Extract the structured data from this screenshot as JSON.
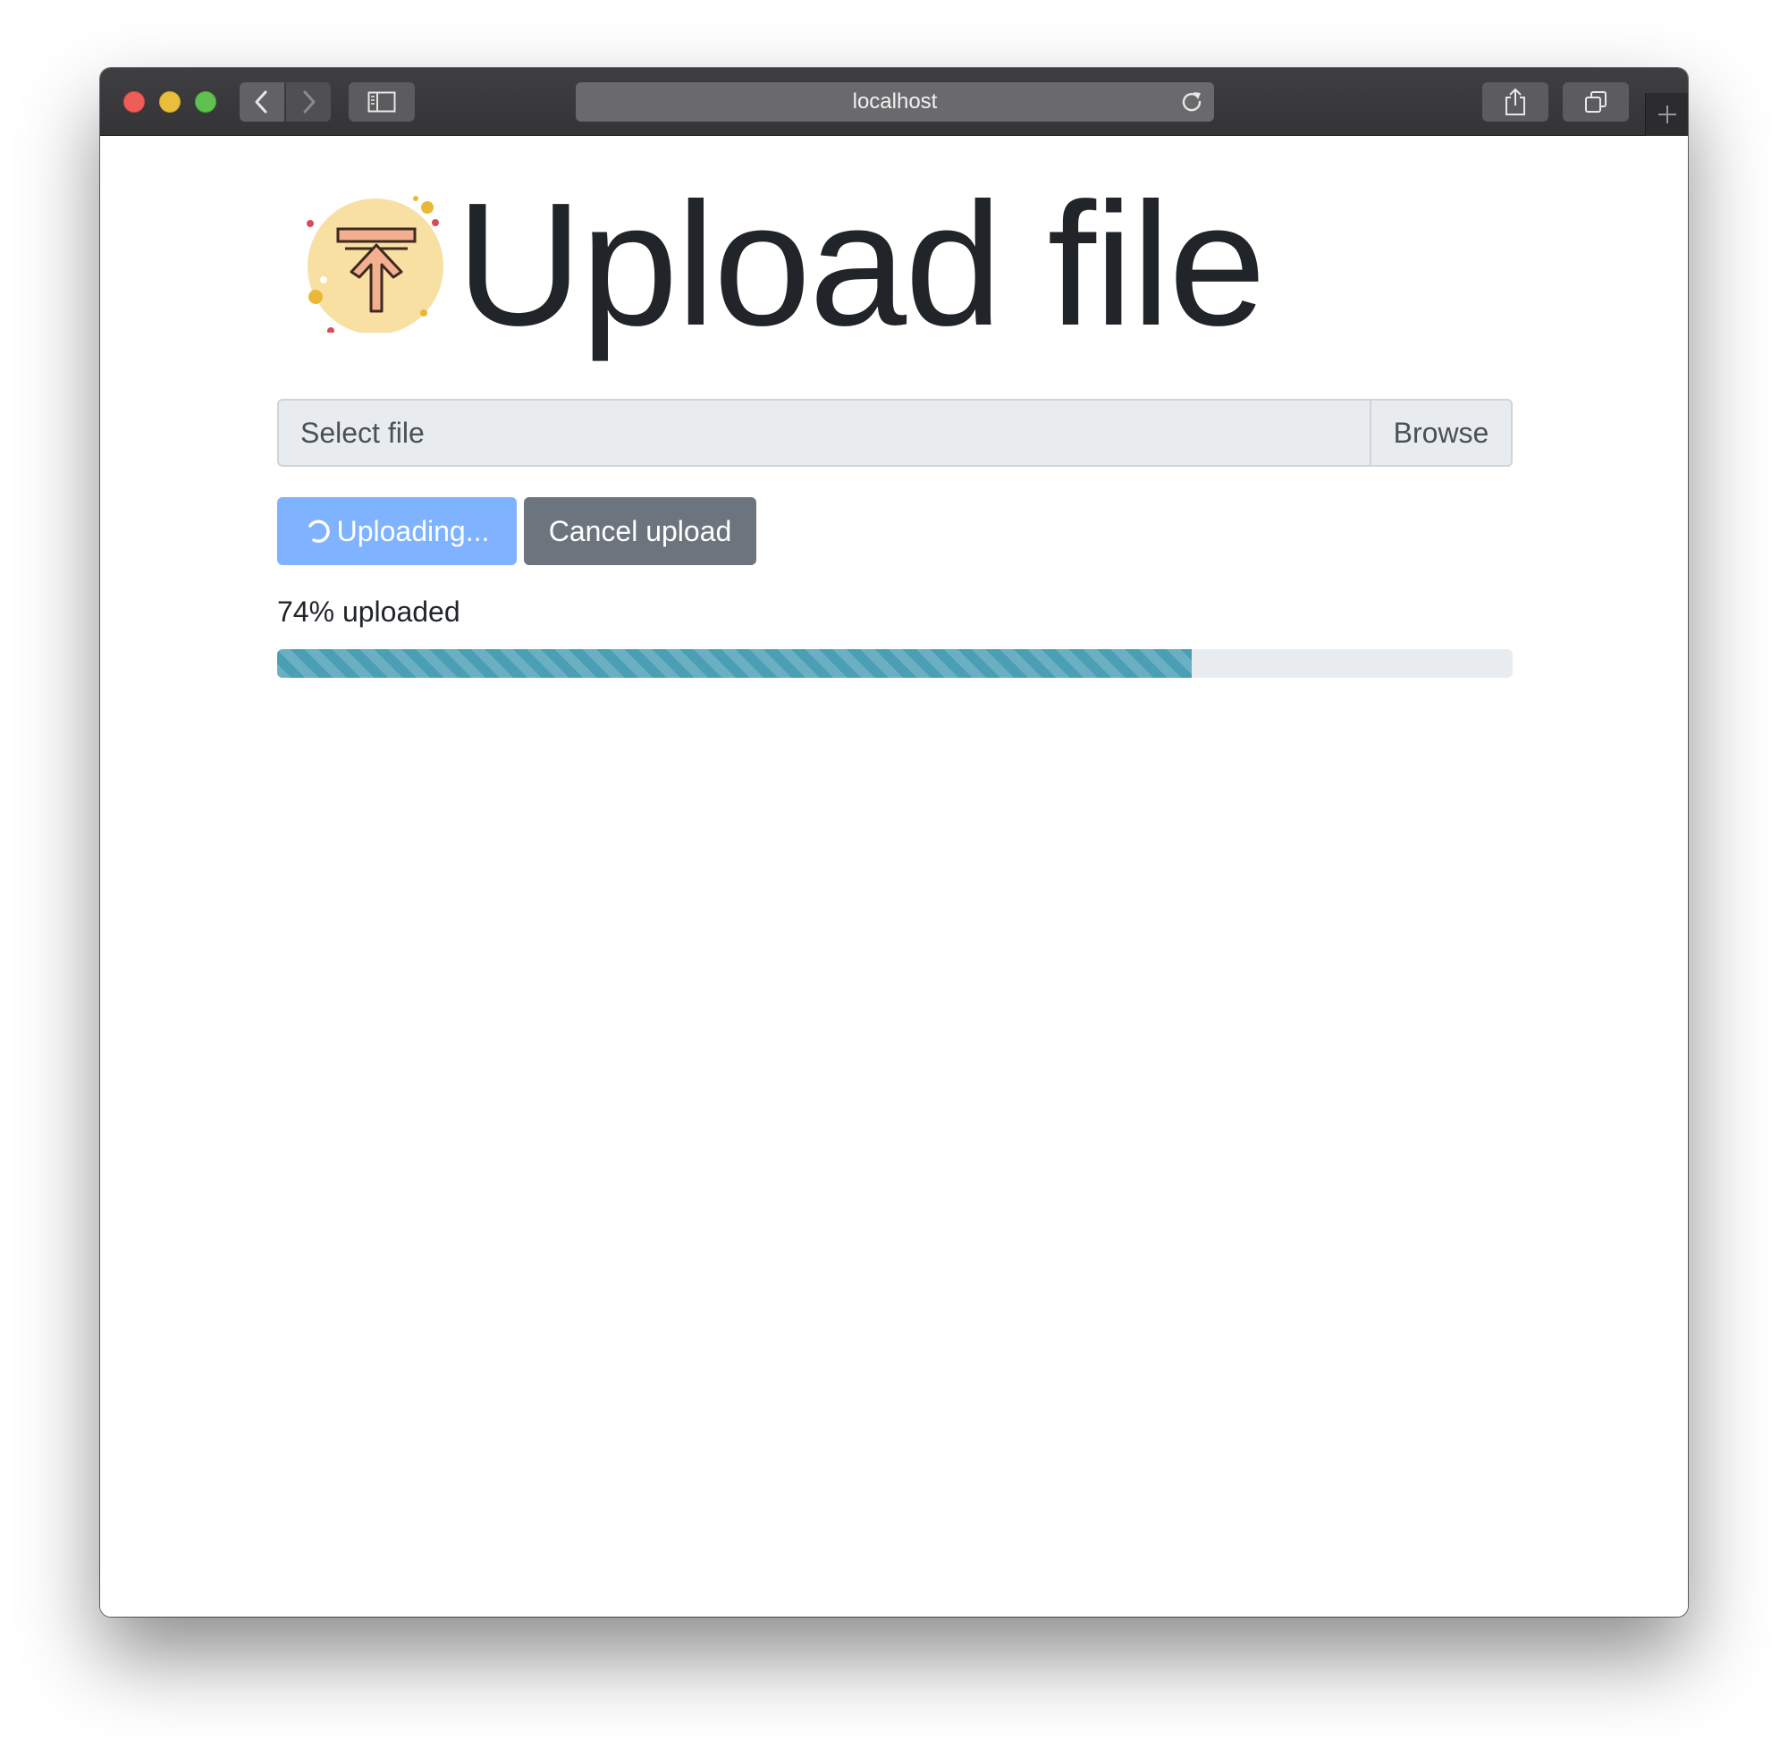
{
  "browser": {
    "url": "localhost"
  },
  "page": {
    "title": "Upload file"
  },
  "file_input": {
    "placeholder": "Select file",
    "browse_label": "Browse"
  },
  "actions": {
    "uploading_label": "Uploading...",
    "cancel_label": "Cancel upload"
  },
  "progress": {
    "label": "74% uploaded",
    "fraction": 0.74
  },
  "icons": {
    "logo": "upload-arrow-icon",
    "back": "chevron-left-icon",
    "forward": "chevron-right-icon",
    "sidebar": "sidebar-icon",
    "reload": "reload-icon",
    "share": "share-icon",
    "tabs": "tabs-icon",
    "new_tab": "plus-icon",
    "spinner": "spinner-icon"
  },
  "colors": {
    "uploading_button": "#80b3ff",
    "cancel_button": "#6c757d",
    "progress_fill": "#4a9fb5",
    "progress_track": "#e9ecef"
  }
}
